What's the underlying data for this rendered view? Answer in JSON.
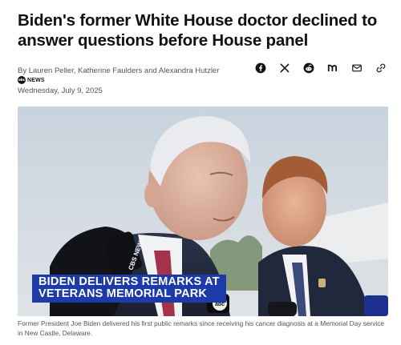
{
  "article": {
    "headline": "Biden's former White House doctor declined to answer questions before House panel",
    "byline_prefix": "By ",
    "authors": "Lauren Peller, Katherine Faulders and Alexandra Hutzler",
    "source_logo_text": "abc",
    "source_name": "NEWS",
    "date": "Wednesday, July 9, 2025"
  },
  "share": {
    "icons": [
      "facebook-icon",
      "x-icon",
      "reddit-icon",
      "newsbreak-icon",
      "email-icon",
      "link-icon"
    ]
  },
  "photo": {
    "lower_third_line1": "BIDEN DELIVERS REMARKS AT",
    "lower_third_line2": "VETERANS MEMORIAL PARK",
    "lower_third_color": "#1c3aa8",
    "mic_flag_text": "CBS NEWS",
    "bug_text": "abc",
    "caption": "Former President Joe Biden delivered his first public remarks since receiving his cancer diagnosis at a Memorial Day service in New Castle, Delaware."
  }
}
